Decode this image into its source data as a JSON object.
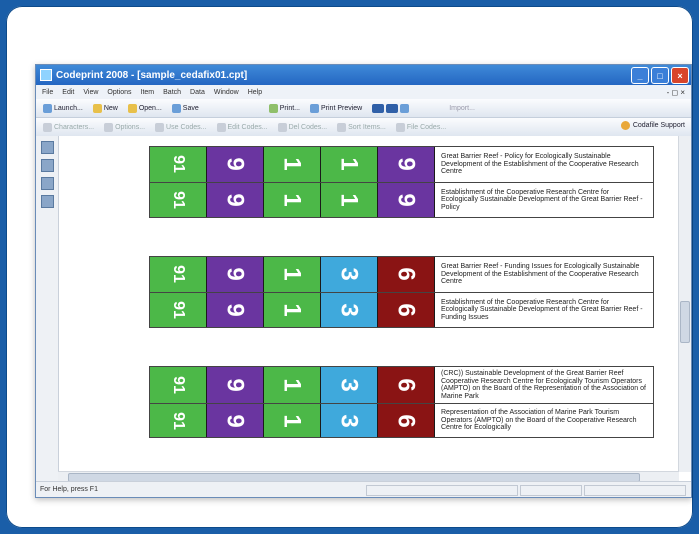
{
  "window": {
    "title": "Codeprint 2008 - [sample_cedafix01.cpt]",
    "min_icon": "_",
    "max_icon": "□",
    "close_icon": "×"
  },
  "menu": [
    "File",
    "Edit",
    "View",
    "Options",
    "Item",
    "Batch",
    "Data",
    "Window",
    "Help"
  ],
  "menu_right": "- ◻ ×",
  "toolbar1": {
    "launch": "Launch...",
    "new": "New",
    "open": "Open...",
    "save": "Save",
    "print": "Print...",
    "print_preview": "Print Preview",
    "import": "Import..."
  },
  "toolbar2": {
    "characters": "Characters...",
    "options": "Options...",
    "use_codes": "Use Codes...",
    "edit_codes": "Edit Codes...",
    "del_codes": "Del Codes...",
    "sort_items": "Sort Items...",
    "file_codes": "File Codes...",
    "support": "Codafile Support"
  },
  "status": "For Help, press F1",
  "labels": [
    {
      "rows": [
        {
          "tiles": [
            [
              "91",
              "green",
              "small"
            ],
            [
              "9",
              "purple"
            ],
            [
              "1",
              "green"
            ],
            [
              "1",
              "green"
            ],
            [
              "9",
              "purple"
            ]
          ],
          "text": "Great Barrier Reef - Policy for Ecologically Sustainable Development of the Establishment of the Cooperative Research Centre"
        },
        {
          "tiles": [
            [
              "91",
              "green",
              "small"
            ],
            [
              "9",
              "purple"
            ],
            [
              "1",
              "green"
            ],
            [
              "1",
              "green"
            ],
            [
              "9",
              "purple"
            ]
          ],
          "text": "Establishment of the Cooperative Research Centre for Ecologically Sustainable Development of the Great Barrier Reef - Policy"
        }
      ]
    },
    {
      "rows": [
        {
          "tiles": [
            [
              "91",
              "green",
              "small"
            ],
            [
              "9",
              "purple"
            ],
            [
              "1",
              "green"
            ],
            [
              "3",
              "blue"
            ],
            [
              "6",
              "red"
            ]
          ],
          "text": "Great Barrier Reef - Funding Issues for Ecologically Sustainable Development of the Establishment of the Cooperative Research Centre"
        },
        {
          "tiles": [
            [
              "91",
              "green",
              "small"
            ],
            [
              "9",
              "purple"
            ],
            [
              "1",
              "green"
            ],
            [
              "3",
              "blue"
            ],
            [
              "6",
              "red"
            ]
          ],
          "text": "Establishment of the Cooperative Research Centre for Ecologically Sustainable Development of the Great Barrier Reef - Funding Issues"
        }
      ]
    },
    {
      "rows": [
        {
          "tiles": [
            [
              "91",
              "green",
              "small"
            ],
            [
              "9",
              "purple"
            ],
            [
              "1",
              "green"
            ],
            [
              "3",
              "blue"
            ],
            [
              "6",
              "red"
            ]
          ],
          "text": "(CRC)) Sustainable Development of the Great Barrier Reef Cooperative Research Centre for Ecologically Tourism Operators (AMPTO) on the Board of the Representation of the Association of Marine Park"
        },
        {
          "tiles": [
            [
              "91",
              "green",
              "small"
            ],
            [
              "9",
              "purple"
            ],
            [
              "1",
              "green"
            ],
            [
              "3",
              "blue"
            ],
            [
              "6",
              "red"
            ]
          ],
          "text": "Representation of the Association of Marine Park Tourism Operators (AMPTO) on the Board of the Cooperative Research Centre for Ecologically"
        }
      ]
    }
  ]
}
